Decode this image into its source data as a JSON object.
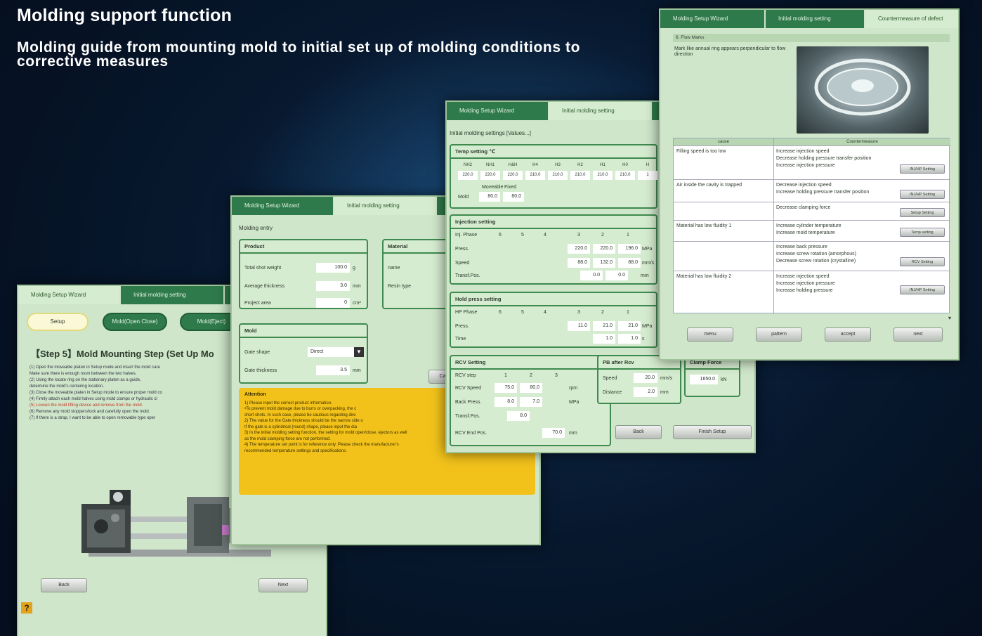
{
  "header": {
    "title": "Molding support function",
    "subtitle": "Molding guide from mounting mold to initial set up of molding conditions to corrective measures"
  },
  "screen1": {
    "tabs": [
      "Molding Setup Wizard",
      "Initial molding setting",
      ""
    ],
    "pills": [
      "Setup",
      "Mold(Open Close)",
      "Mold(Eject)"
    ],
    "step_title": "【Step 5】Mold Mounting Step (Set Up Mo",
    "instructions": [
      "(1) Open the moveable platen in Setup mode and insert the mold care",
      "     Make sure there is enough room between the two halves.",
      "(2) Using the locate ring on the stationary platen as a guide,",
      "     determine the mold's centering location.",
      "(3) Close the moveable platen in Setup mode to ensure proper mold co",
      "(4) Firmly attach each mold halves using mold clamps or hydraulic cl",
      "(5) Loosen the mold lifting device and remove from the mold.",
      "(6) Remove any mold stoppers/lock and carefully open the mold.",
      "(7) If there is a strap, I want to be able to open removable type oper"
    ],
    "back": "Back",
    "next": "Next",
    "help": "?"
  },
  "screen2": {
    "tabs": [
      "Molding Setup Wizard",
      "Initial molding setting",
      ""
    ],
    "section": "Molding entry",
    "product": {
      "title": "Product",
      "rows": [
        {
          "label": "Total shot weight",
          "value": "100.0",
          "unit": "g"
        },
        {
          "label": "Average thickness",
          "value": "3.0",
          "unit": "mm"
        },
        {
          "label": "Project area",
          "value": "0",
          "unit": "cm²"
        }
      ]
    },
    "mold": {
      "title": "Mold",
      "rows": [
        {
          "label": "Gate shape",
          "value": "Direct",
          "unit": ""
        },
        {
          "label": "Gate thickness",
          "value": "3.5",
          "unit": "mm"
        }
      ]
    },
    "material": {
      "title": "Material",
      "rows": [
        "name",
        "Resin type"
      ]
    },
    "attention_title": "Attention",
    "attention": [
      "1) Please input the correct product information.",
      "   •To prevent mold damage due to burrs or overpacking, the c",
      "   short shots. In such case, please be cautious regarding dire",
      "2) The value for the Gate thickness should be the narrow side o",
      "   If the gate is a cylindrical (round) shape, please input the dia",
      "3) In the initial molding setting function, the setting for mold open/close, ejectors as well",
      "   as the mold clamping force are not performed.",
      "4) The temperature set point is for reference only. Please check the manufacturer's",
      "   recommended temperature settings and specifications."
    ],
    "button": "Ca"
  },
  "screen3": {
    "tabs": [
      "Molding Setup Wizard",
      "Initial molding setting",
      ""
    ],
    "section": "Initial molding settings [Values...]",
    "temp": {
      "title": "Temp setting ℃",
      "heads": [
        "NH2",
        "NH1",
        "H&H",
        "H4",
        "H3",
        "H2",
        "H1",
        "H0",
        "H"
      ],
      "values": [
        "220.0",
        "220.0",
        "220.0",
        "210.0",
        "210.0",
        "210.0",
        "210.0",
        "210.0",
        "1"
      ],
      "mold_heads": [
        "Moveable",
        "Fixed"
      ],
      "mold_label": "Mold",
      "mold_values": [
        "80.0",
        "80.0"
      ]
    },
    "injection": {
      "title": "Injection setting",
      "heads": [
        "Inj. Phase",
        "6",
        "5",
        "4",
        "3",
        "2",
        "1"
      ],
      "rows": [
        {
          "label": "Press.",
          "values": [
            "220.0",
            "220.0",
            "196.0"
          ],
          "unit": "MPa"
        },
        {
          "label": "Speed",
          "values": [
            "88.0",
            "132.0",
            "88.0"
          ],
          "unit": "mm/s"
        },
        {
          "label": "Transf.Pos.",
          "values": [
            "0.0",
            "0.0"
          ],
          "unit": "mm"
        }
      ]
    },
    "hold": {
      "title": "Hold press setting",
      "heads": [
        "HP Phase",
        "6",
        "5",
        "4",
        "3",
        "2",
        "1"
      ],
      "rows": [
        {
          "label": "Press.",
          "values": [
            "11.0",
            "21.0",
            "21.0"
          ],
          "unit": "MPa"
        },
        {
          "label": "Time",
          "values": [
            "1.0",
            "1.0"
          ],
          "unit": "s"
        }
      ]
    },
    "rcv": {
      "title": "RCV Setting",
      "heads": [
        "RCV step",
        "1",
        "2",
        "3"
      ],
      "rows": [
        {
          "label": "RCV Speed",
          "values": [
            "75.0",
            "80.0"
          ],
          "unit": "rpm"
        },
        {
          "label": "Back Press.",
          "values": [
            "8.0",
            "7.0"
          ],
          "unit": "MPa"
        },
        {
          "label": "Transf.Pos.",
          "values": [
            "8.0"
          ],
          "unit": ""
        },
        {
          "label": "RCV End Pos.",
          "values": [
            "70.0"
          ],
          "unit": "mm"
        }
      ]
    },
    "pb": {
      "title": "PB after Rcv",
      "rows": [
        {
          "label": "Speed",
          "value": "20.0",
          "unit": "mm/s"
        },
        {
          "label": "Distance",
          "value": "2.0",
          "unit": "mm"
        }
      ]
    },
    "clamp": {
      "title": "Clamp Force",
      "value": "1650.0",
      "unit": "kN"
    },
    "back": "Back",
    "finish": "Finish Setup"
  },
  "screen4": {
    "tabs": [
      "Molding Setup Wizard",
      "Initial molding setting",
      "Countermeasure of defect"
    ],
    "defect": "6. Flow Marks",
    "description": "Mark like annual ring appears perpendicular to flow direction",
    "col_cause": "cause",
    "col_counter": "Countermeasure",
    "rows": [
      {
        "cause": "Filling speed is too low",
        "measures": [
          "Increase injection speed",
          "Decrease holding pressure transfer position",
          "Increase injection pressure"
        ],
        "button": "INJ/HP Setting"
      },
      {
        "cause": "Air inside the cavity is trapped",
        "measures": [
          "Decrease injection speed",
          "Increase holding pressure transfer position"
        ],
        "button": "INJ/HP Setting"
      },
      {
        "cause": "",
        "measures": [
          "Decrease clamping force"
        ],
        "button": "Setup Setting"
      },
      {
        "cause": "Material has low fluidity 1",
        "measures": [
          "Increase cylinder temperature",
          "Increase mold temperature"
        ],
        "button": "Temp setting"
      },
      {
        "cause": "",
        "measures": [
          "Increase back pressure",
          "Increase screw rotation (amorphous)",
          "Decrease screw rotation (crystalline)"
        ],
        "button": "RCV Setting"
      },
      {
        "cause": "Material has low fluidity 2",
        "measures": [
          "Increase injection speed",
          "Increase injection pressure",
          "Increase holding pressure"
        ],
        "button": "INJ/HP Setting"
      }
    ],
    "footer": [
      "menu",
      "pattern",
      "accept",
      "next"
    ]
  }
}
